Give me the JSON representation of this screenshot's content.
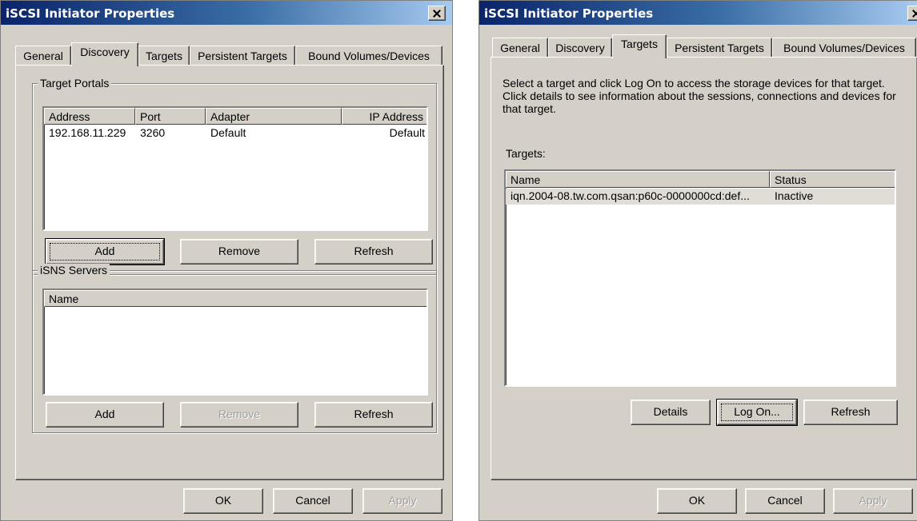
{
  "left_dialog": {
    "title": "iSCSI Initiator Properties",
    "tabs": [
      "General",
      "Discovery",
      "Targets",
      "Persistent Targets",
      "Bound Volumes/Devices"
    ],
    "active_tab": "Discovery",
    "target_portals": {
      "label": "Target Portals",
      "columns": [
        "Address",
        "Port",
        "Adapter",
        "IP Address"
      ],
      "rows": [
        [
          "192.168.11.229",
          "3260",
          "Default",
          "Default"
        ]
      ],
      "buttons": {
        "add": "Add",
        "remove": "Remove",
        "refresh": "Refresh"
      }
    },
    "isns_servers": {
      "label": "iSNS Servers",
      "columns": [
        "Name"
      ],
      "rows": [],
      "buttons": {
        "add": "Add",
        "remove": "Remove",
        "refresh": "Refresh"
      },
      "remove_disabled": true
    },
    "footer": {
      "ok": "OK",
      "cancel": "Cancel",
      "apply": "Apply"
    }
  },
  "right_dialog": {
    "title": "iSCSI Initiator Properties",
    "tabs": [
      "General",
      "Discovery",
      "Targets",
      "Persistent Targets",
      "Bound Volumes/Devices"
    ],
    "active_tab": "Targets",
    "description": "Select a target and click Log On to access the storage devices for that target. Click details to see information about the sessions, connections and devices for that target.",
    "targets_label": "Targets:",
    "targets": {
      "columns": [
        "Name",
        "Status"
      ],
      "rows": [
        [
          "iqn.2004-08.tw.com.qsan:p60c-0000000cd:def...",
          "Inactive"
        ]
      ]
    },
    "buttons": {
      "details": "Details",
      "log_on": "Log On...",
      "refresh": "Refresh"
    },
    "footer": {
      "ok": "OK",
      "cancel": "Cancel",
      "apply": "Apply"
    }
  }
}
